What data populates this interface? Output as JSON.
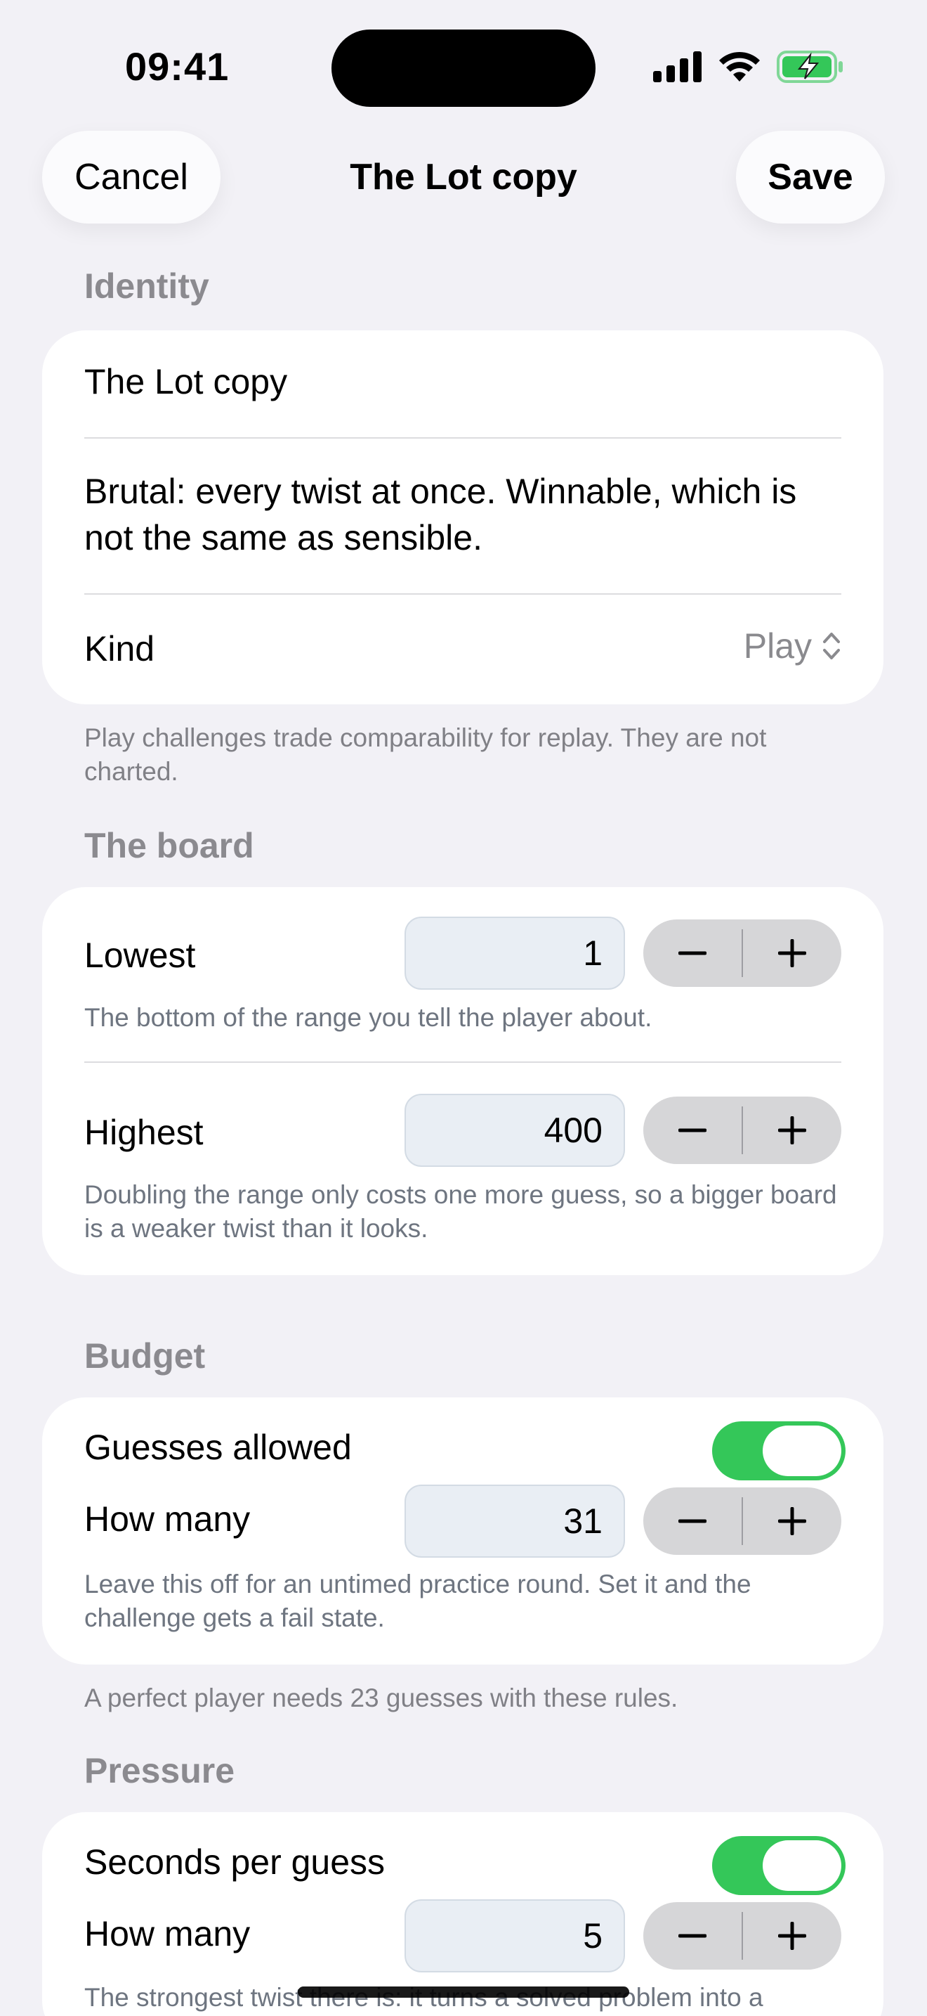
{
  "status": {
    "time": "09:41"
  },
  "nav": {
    "cancel": "Cancel",
    "title": "The Lot copy",
    "save": "Save"
  },
  "identity": {
    "header": "Identity",
    "name": "The Lot copy",
    "description": "Brutal: every twist at once. Winnable, which is not the same as sensible.",
    "kind_label": "Kind",
    "kind_value": "Play",
    "footnote": "Play challenges trade comparability for replay. They are not charted."
  },
  "board": {
    "header": "The board",
    "lowest_label": "Lowest",
    "lowest_value": "1",
    "lowest_note": "The bottom of the range you tell the player about.",
    "highest_label": "Highest",
    "highest_value": "400",
    "highest_note": "Doubling the range only costs one more guess, so a bigger board is a weaker twist than it looks."
  },
  "budget": {
    "header": "Budget",
    "toggle_label": "Guesses allowed",
    "toggle_on": true,
    "count_label": "How many",
    "count_value": "31",
    "note": "Leave this off for an untimed practice round. Set it and the challenge gets a fail state.",
    "footnote": "A perfect player needs 23 guesses with these rules."
  },
  "pressure": {
    "header": "Pressure",
    "toggle_label": "Seconds per guess",
    "toggle_on": true,
    "count_label": "How many",
    "count_value": "5",
    "note": "The strongest twist there is: it turns a solved problem into a"
  },
  "colors": {
    "accent_green": "#34c759",
    "background": "#f2f1f6"
  }
}
